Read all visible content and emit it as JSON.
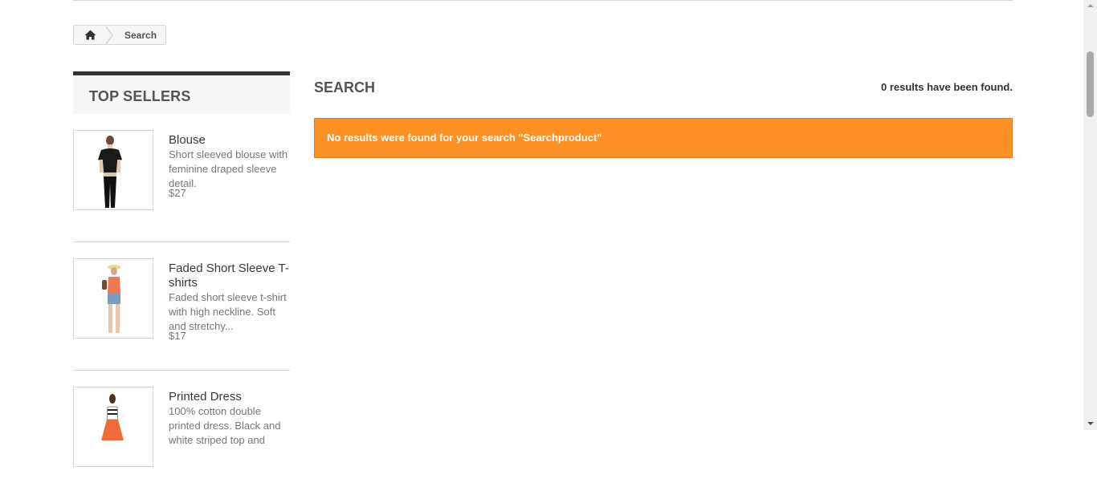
{
  "breadcrumb": {
    "home_icon": "home-icon",
    "current": "Search"
  },
  "sidebar": {
    "title": "TOP SELLERS",
    "products": [
      {
        "name": "Blouse",
        "description": "Short sleeved blouse with feminine draped sleeve detail.",
        "price": "$27"
      },
      {
        "name": "Faded Short Sleeve T-shirts",
        "description": "Faded short sleeve t-shirt with high neckline. Soft and stretchy...",
        "price": "$17"
      },
      {
        "name": "Printed Dress",
        "description": "100% cotton double printed dress. Black and white striped top and",
        "price": ""
      }
    ]
  },
  "main": {
    "title": "SEARCH",
    "results_count": "0 results have been found.",
    "alert": "No results were found for your search \"Searchproduct\""
  },
  "colors": {
    "alert_bg": "#fe9126",
    "title_border": "#333333"
  }
}
